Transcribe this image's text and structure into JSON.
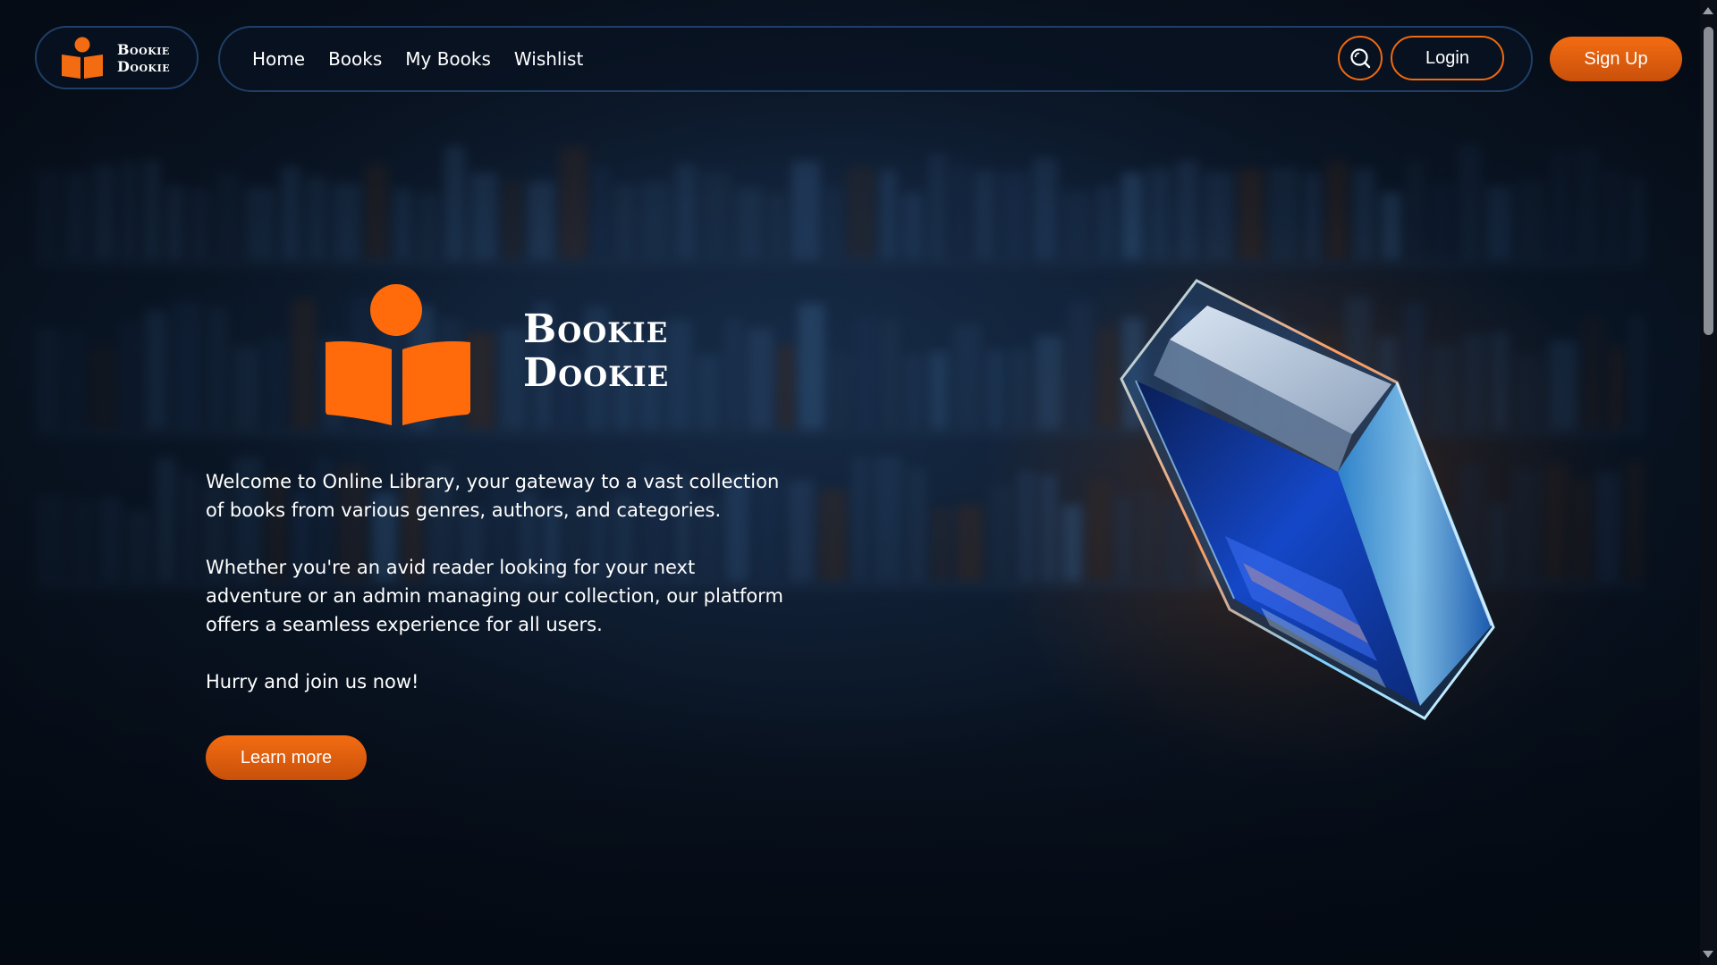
{
  "brand": {
    "name_line1": "Bookie",
    "name_line2": "Dookie",
    "accent_color": "#f36c12"
  },
  "nav": {
    "links": [
      "Home",
      "Books",
      "My Books",
      "Wishlist"
    ],
    "search_icon": "search-icon",
    "login_label": "Login",
    "signup_label": "Sign Up"
  },
  "hero": {
    "title_line1": "Bookie",
    "title_line2": "Dookie",
    "paragraph1": "Welcome to Online Library, your gateway to a vast collection of books from various genres, authors, and categories.",
    "paragraph2": "Whether you're an avid reader looking for your next adventure or an admin managing our collection, our platform offers a seamless experience for all users.",
    "paragraph3": "Hurry and join us now!",
    "cta_label": "Learn more",
    "illustration": "glass-book"
  },
  "colors": {
    "background": "#07111f",
    "border": "#1f3f66",
    "accent": "#f36c12"
  }
}
